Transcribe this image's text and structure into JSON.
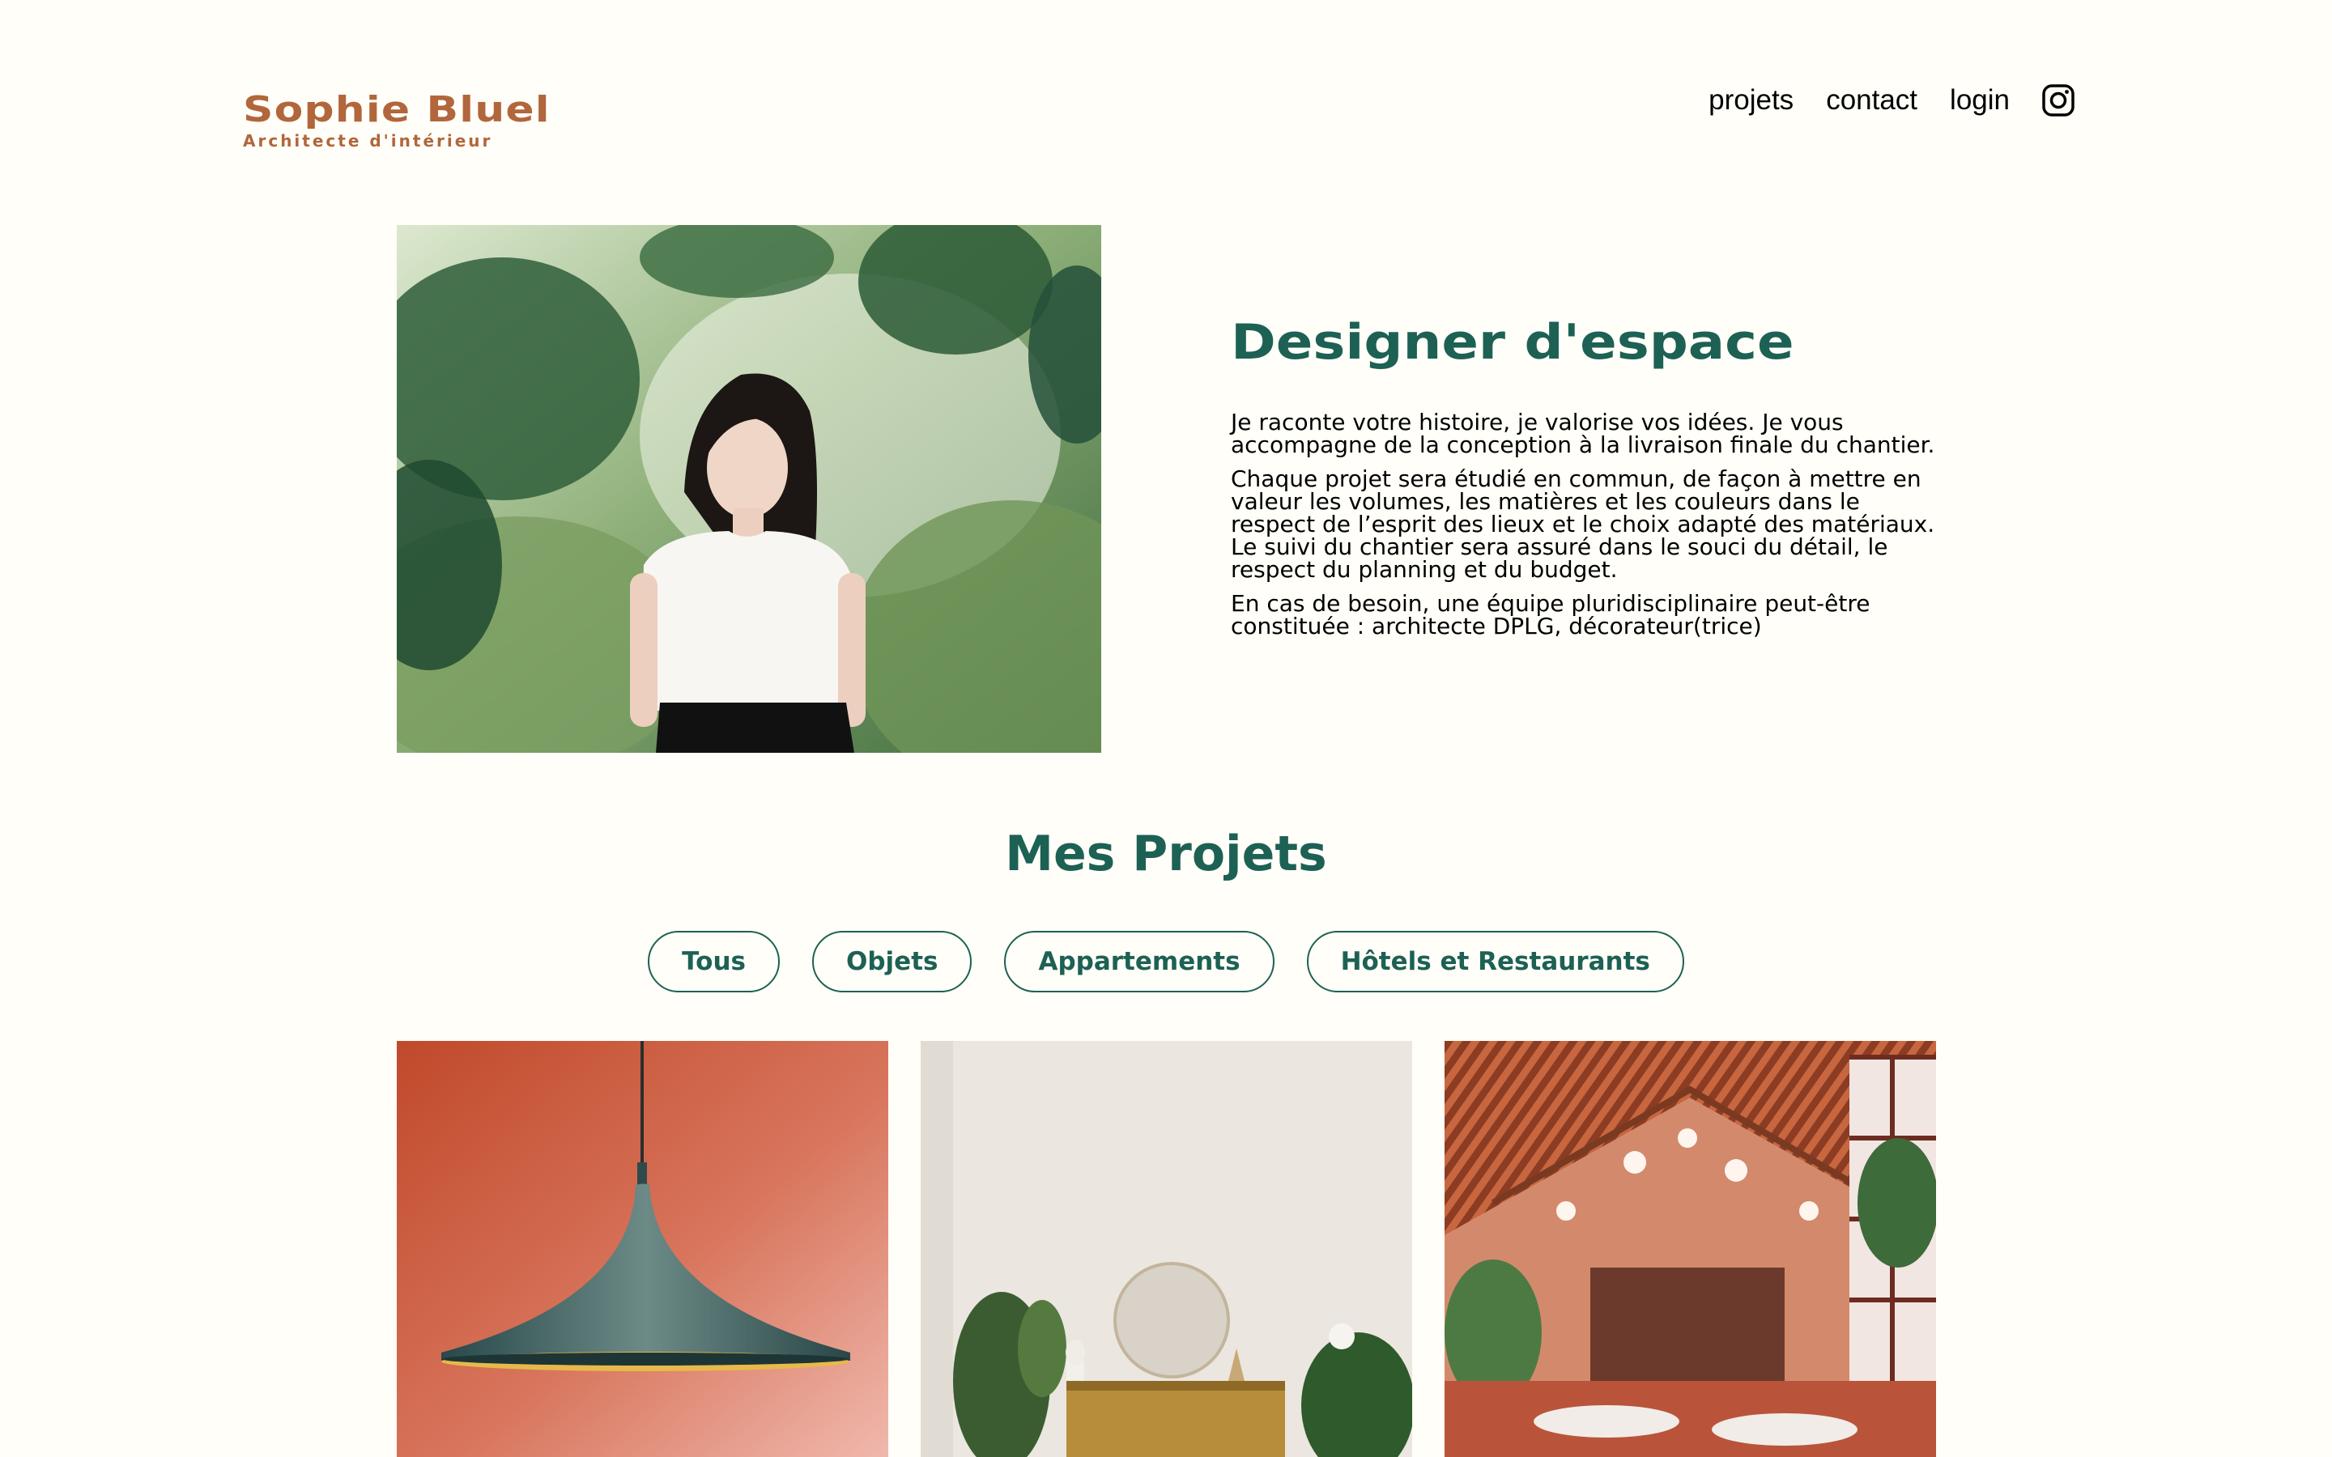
{
  "header": {
    "logo_name": "Sophie Bluel",
    "logo_subtitle": "Architecte d'intérieur",
    "nav": [
      {
        "label": "projets"
      },
      {
        "label": "contact"
      },
      {
        "label": "login"
      }
    ],
    "social_icon": "instagram-icon"
  },
  "intro": {
    "title": "Designer d'espace",
    "paragraphs": [
      "Je raconte votre histoire, je valorise vos idées. Je vous accompagne de la conception à la livraison finale du chantier.",
      "Chaque projet sera étudié en commun, de façon à mettre en valeur les volumes, les matières et les couleurs dans le respect de l’esprit des lieux et le choix adapté des matériaux. Le suivi du chantier sera assuré dans le souci du détail, le respect du planning et du budget.",
      "En cas de besoin, une équipe pluridisciplinaire peut-être constituée : architecte DPLG, décorateur(trice)"
    ]
  },
  "portfolio": {
    "title": "Mes Projets",
    "filters": [
      {
        "label": "Tous"
      },
      {
        "label": "Objets"
      },
      {
        "label": "Appartements"
      },
      {
        "label": "Hôtels et Restaurants"
      }
    ]
  },
  "colors": {
    "brand": "#b1663c",
    "accent": "#1d6154",
    "background": "#fffef8"
  }
}
